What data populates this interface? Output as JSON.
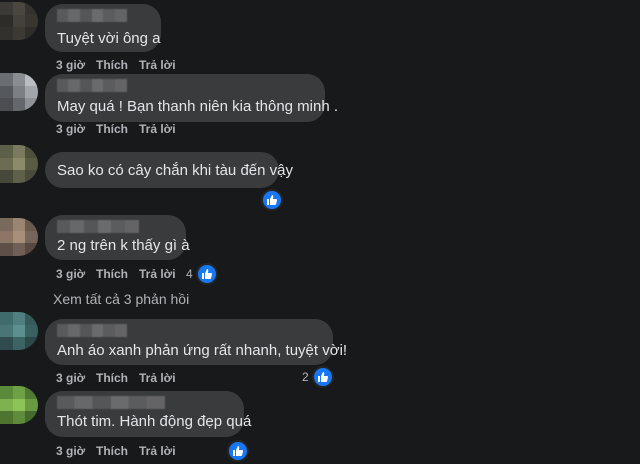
{
  "comments": [
    {
      "text": "Tuyệt vời ông a",
      "time": "3 giờ",
      "like": "Thích",
      "reply": "Trả lời",
      "reaction_count": null
    },
    {
      "text": "May quá ! Bạn thanh niên kia thông minh .",
      "time": "3 giờ",
      "like": "Thích",
      "reply": "Trả lời",
      "reaction_count": null
    },
    {
      "text": "Sao ko có cây chắn khi tàu đến vậy",
      "time": "",
      "like": "",
      "reply": "",
      "reaction_count": null
    },
    {
      "text": "2 ng trên k thấy gì à",
      "time": "3 giờ",
      "like": "Thích",
      "reply": "Trả lời",
      "reaction_count": "4"
    },
    {
      "text": "Anh áo xanh phản ứng rất nhanh, tuyệt vời!",
      "time": "3 giờ",
      "like": "Thích",
      "reply": "Trả lời",
      "reaction_count": "2"
    },
    {
      "text": "Thót tim. Hành động đẹp quá",
      "time": "3 giờ",
      "like": "Thích",
      "reply": "Trả lời",
      "reaction_count": null
    }
  ],
  "view_more_replies": "Xem tất cả 3 phản hồi",
  "icons": {
    "reaction": "like-thumb-icon"
  },
  "colors": {
    "background": "#18191a",
    "bubble": "#3a3b3c",
    "like_blue": "#1877f2",
    "secondary_text": "#b0b3b8"
  }
}
